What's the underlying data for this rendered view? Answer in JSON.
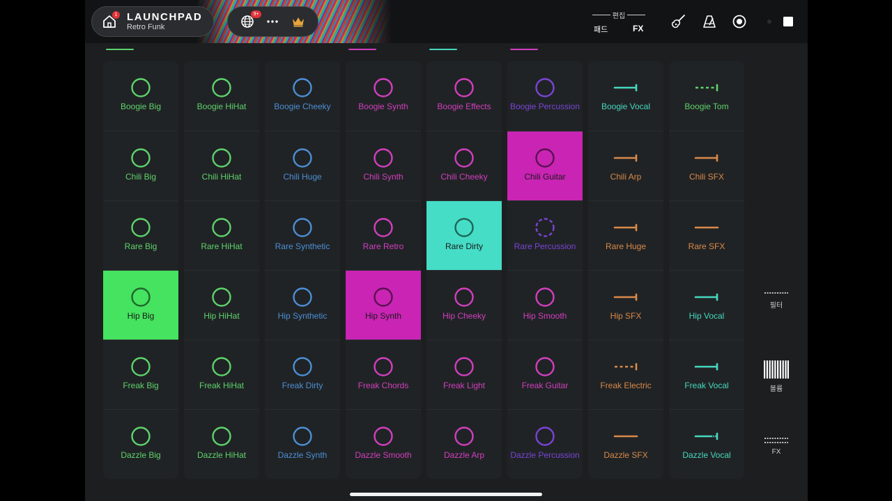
{
  "header": {
    "brand_title": "LAUNCHPAD",
    "brand_subtitle": "Retro Funk",
    "home_badge": "1",
    "globe_badge": "9+",
    "more_label": "···",
    "mode_edit": "편집",
    "mode_pad": "패드",
    "mode_fx": "FX"
  },
  "colors": {
    "green": "#5ed36c",
    "blue": "#4c8fd6",
    "magenta": "#d23fbf",
    "violet": "#7a44d6",
    "teal": "#46d9c0",
    "orange": "#d98a4a",
    "active_green": "#45e35f",
    "active_magenta": "#c924b4",
    "active_teal": "#45ddc6"
  },
  "column_indicators": [
    {
      "col": 0,
      "color": "#5ed36c"
    },
    {
      "col": 3,
      "color": "#d23fbf"
    },
    {
      "col": 4,
      "color": "#46d9c0"
    },
    {
      "col": 5,
      "color": "#d23fbf"
    }
  ],
  "pads": [
    [
      {
        "label": "Boogie Big",
        "color": "#5ed36c",
        "icon": "circle"
      },
      {
        "label": "Chili Big",
        "color": "#5ed36c",
        "icon": "circle"
      },
      {
        "label": "Rare Big",
        "color": "#5ed36c",
        "icon": "circle"
      },
      {
        "label": "Hip Big",
        "color": "#5ed36c",
        "icon": "circle",
        "active": true,
        "bg": "#45e35f"
      },
      {
        "label": "Freak Big",
        "color": "#5ed36c",
        "icon": "circle"
      },
      {
        "label": "Dazzle Big",
        "color": "#5ed36c",
        "icon": "circle"
      }
    ],
    [
      {
        "label": "Boogie HiHat",
        "color": "#5ed36c",
        "icon": "circle"
      },
      {
        "label": "Chili HiHat",
        "color": "#5ed36c",
        "icon": "circle"
      },
      {
        "label": "Rare HiHat",
        "color": "#5ed36c",
        "icon": "circle"
      },
      {
        "label": "Hip HiHat",
        "color": "#5ed36c",
        "icon": "circle"
      },
      {
        "label": "Freak HiHat",
        "color": "#5ed36c",
        "icon": "circle"
      },
      {
        "label": "Dazzle HiHat",
        "color": "#5ed36c",
        "icon": "circle"
      }
    ],
    [
      {
        "label": "Boogie Cheeky",
        "color": "#4c8fd6",
        "icon": "circle"
      },
      {
        "label": "Chili Huge",
        "color": "#4c8fd6",
        "icon": "circle"
      },
      {
        "label": "Rare Synthetic",
        "color": "#4c8fd6",
        "icon": "circle"
      },
      {
        "label": "Hip Synthetic",
        "color": "#4c8fd6",
        "icon": "circle"
      },
      {
        "label": "Freak Dirty",
        "color": "#4c8fd6",
        "icon": "circle"
      },
      {
        "label": "Dazzle Synth",
        "color": "#4c8fd6",
        "icon": "circle"
      }
    ],
    [
      {
        "label": "Boogie Synth",
        "color": "#d23fbf",
        "icon": "circle"
      },
      {
        "label": "Chili Synth",
        "color": "#d23fbf",
        "icon": "circle"
      },
      {
        "label": "Rare Retro",
        "color": "#d23fbf",
        "icon": "circle"
      },
      {
        "label": "Hip Synth",
        "color": "#d23fbf",
        "icon": "circle",
        "active": true,
        "bg": "#c924b4"
      },
      {
        "label": "Freak Chords",
        "color": "#d23fbf",
        "icon": "circle"
      },
      {
        "label": "Dazzle Smooth",
        "color": "#d23fbf",
        "icon": "circle"
      }
    ],
    [
      {
        "label": "Boogie Effects",
        "color": "#d23fbf",
        "icon": "circle"
      },
      {
        "label": "Chili Cheeky",
        "color": "#d23fbf",
        "icon": "circle"
      },
      {
        "label": "Rare Dirty",
        "color": "#46d9c0",
        "icon": "circle",
        "active": true,
        "bg": "#45ddc6"
      },
      {
        "label": "Hip Cheeky",
        "color": "#d23fbf",
        "icon": "circle"
      },
      {
        "label": "Freak Light",
        "color": "#d23fbf",
        "icon": "circle"
      },
      {
        "label": "Dazzle Arp",
        "color": "#d23fbf",
        "icon": "circle"
      }
    ],
    [
      {
        "label": "Boogie Percussion",
        "color": "#7a44d6",
        "icon": "circle"
      },
      {
        "label": "Chili Guitar",
        "color": "#d23fbf",
        "icon": "circle",
        "active": true,
        "bg": "#c924b4"
      },
      {
        "label": "Rare Percussion",
        "color": "#7a44d6",
        "icon": "dashed-circle"
      },
      {
        "label": "Hip Smooth",
        "color": "#d23fbf",
        "icon": "circle"
      },
      {
        "label": "Freak Guitar",
        "color": "#d23fbf",
        "icon": "circle"
      },
      {
        "label": "Dazzle Percussion",
        "color": "#7a44d6",
        "icon": "circle"
      }
    ],
    [
      {
        "label": "Boogie Vocal",
        "color": "#46d9c0",
        "icon": "line-end"
      },
      {
        "label": "Chili Arp",
        "color": "#d98a4a",
        "icon": "line-end"
      },
      {
        "label": "Rare Huge",
        "color": "#d98a4a",
        "icon": "line-end"
      },
      {
        "label": "Hip SFX",
        "color": "#d98a4a",
        "icon": "line-end"
      },
      {
        "label": "Freak Electric",
        "color": "#d98a4a",
        "icon": "dashed-line"
      },
      {
        "label": "Dazzle SFX",
        "color": "#d98a4a",
        "icon": "line"
      }
    ],
    [
      {
        "label": "Boogie Tom",
        "color": "#5ed36c",
        "icon": "dashed-line"
      },
      {
        "label": "Chili SFX",
        "color": "#d98a4a",
        "icon": "line-end"
      },
      {
        "label": "Rare SFX",
        "color": "#d98a4a",
        "icon": "line"
      },
      {
        "label": "Hip Vocal",
        "color": "#46d9c0",
        "icon": "line-end"
      },
      {
        "label": "Freak Vocal",
        "color": "#46d9c0",
        "icon": "line-end"
      },
      {
        "label": "Dazzle Vocal",
        "color": "#46d9c0",
        "icon": "dotted-line-end"
      }
    ]
  ],
  "side_controls": {
    "filter": "필터",
    "volume": "볼륨",
    "fx": "FX"
  }
}
